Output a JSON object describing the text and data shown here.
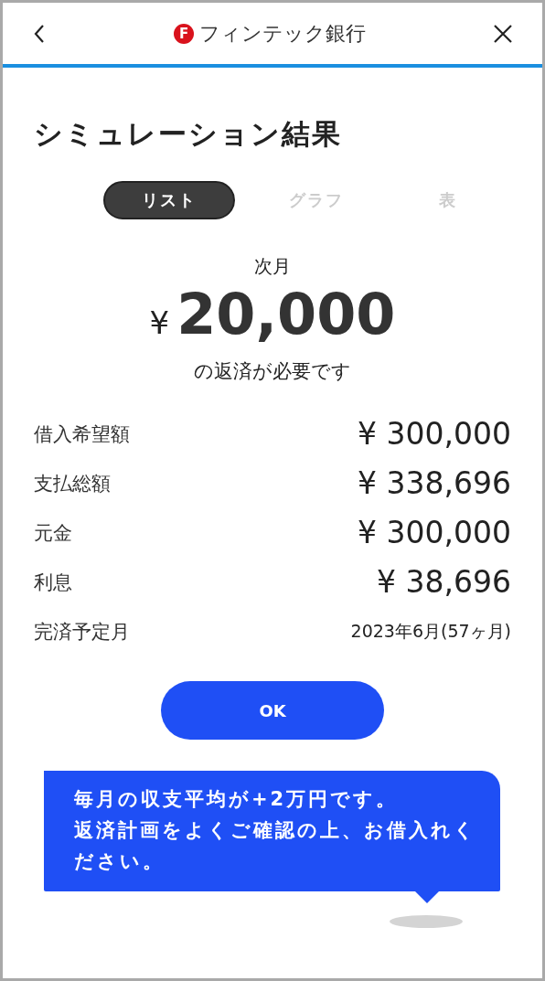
{
  "header": {
    "logo_letter": "F",
    "title": "フィンテック銀行"
  },
  "page_title": "シミュレーション結果",
  "tabs": [
    {
      "label": "リスト",
      "selected": true
    },
    {
      "label": "グラフ",
      "selected": false
    },
    {
      "label": "表",
      "selected": false
    }
  ],
  "summary": {
    "caption": "次月",
    "currency": "¥",
    "amount": "20,000",
    "note": "の返済が必要です"
  },
  "details": [
    {
      "label": "借入希望額",
      "value": "¥ 300,000",
      "kind": "money"
    },
    {
      "label": "支払総額",
      "value": "¥ 338,696",
      "kind": "money"
    },
    {
      "label": "元金",
      "value": "¥ 300,000",
      "kind": "money"
    },
    {
      "label": "利息",
      "value": "¥ 38,696",
      "kind": "money"
    },
    {
      "label": "完済予定月",
      "value": "2023年6月(57ヶ月)",
      "kind": "date"
    }
  ],
  "ok_button": "OK",
  "message": [
    "毎月の収支平均が+2万円です。",
    "返済計画をよくご確認の上、お借入れください。"
  ]
}
